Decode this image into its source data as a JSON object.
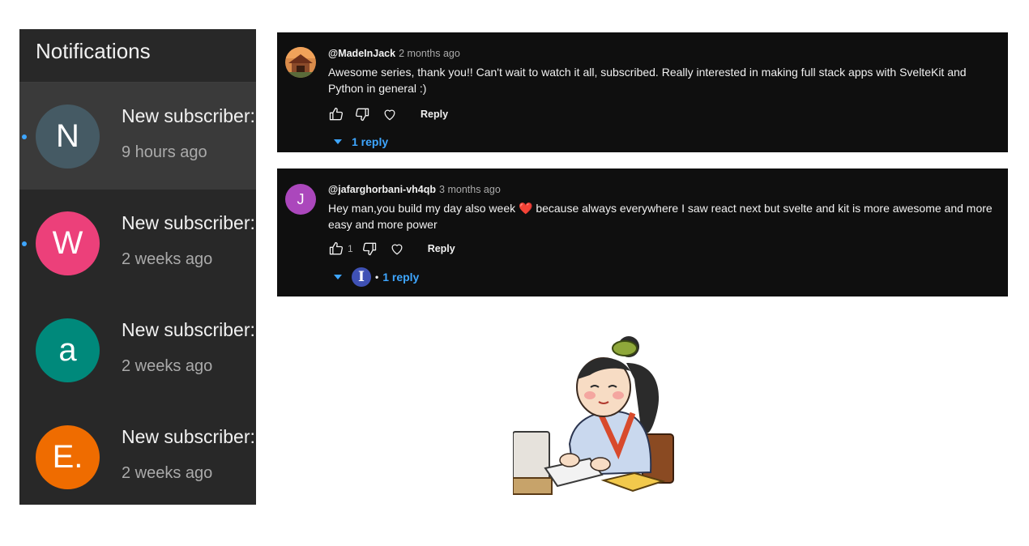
{
  "notifications": {
    "title": "Notifications",
    "items": [
      {
        "initial": "N",
        "color": "#455a64",
        "text": "New subscriber:",
        "time": "9 hours ago",
        "unread": true,
        "active": true
      },
      {
        "initial": "W",
        "color": "#ec407a",
        "text": "New subscriber:",
        "time": "2 weeks ago",
        "unread": true,
        "active": false
      },
      {
        "initial": "a",
        "color": "#00897b",
        "text": "New subscriber:",
        "time": "2 weeks ago",
        "unread": false,
        "active": false
      },
      {
        "initial": "E.",
        "color": "#ef6c00",
        "text": "New subscriber:",
        "time": "2 weeks ago",
        "unread": false,
        "active": false
      }
    ]
  },
  "comments": [
    {
      "username": "@MadeInJack",
      "time": "2 months ago",
      "body": "Awesome series, thank you!! Can't wait to watch it all, subscribed. Really interested in making full stack apps with SvelteKit and Python in general :)",
      "avatar": "photo",
      "likes": "",
      "reply_label": "Reply",
      "replies_label": "1 reply"
    },
    {
      "username": "@jafarghorbani-vh4qb",
      "time": "3 months ago",
      "body_before": "Hey man,you build my day also week ",
      "emoji": "❤️",
      "body_after": " because always everywhere I saw react next but svelte and kit is more awesome and more easy and more power",
      "avatar_initial": "J",
      "avatar_color": "#ab47bc",
      "likes": "1",
      "reply_label": "Reply",
      "replier_initial": "I",
      "replies_label": "1 reply"
    }
  ],
  "colors": {
    "accent": "#3ea6ff",
    "panel": "#282828",
    "card": "#0f0f0f"
  }
}
